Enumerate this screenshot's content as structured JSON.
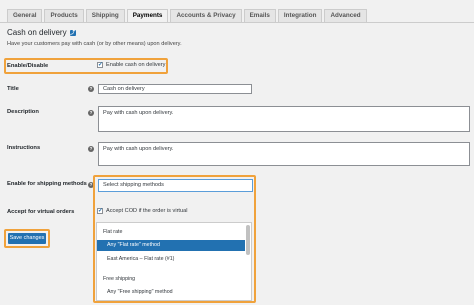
{
  "tabs": [
    "General",
    "Products",
    "Shipping",
    "Payments",
    "Accounts & Privacy",
    "Emails",
    "Integration",
    "Advanced"
  ],
  "active_tab": "Payments",
  "section": {
    "title": "Cash on delivery",
    "description": "Have your customers pay with cash (or by other means) upon delivery."
  },
  "fields": {
    "enable": {
      "label": "Enable/Disable",
      "checkbox_label": "Enable cash on delivery",
      "checked": true
    },
    "title": {
      "label": "Title",
      "value": "Cash on delivery"
    },
    "description": {
      "label": "Description",
      "value": "Pay with cash upon delivery."
    },
    "instructions": {
      "label": "Instructions",
      "value": "Pay with cash upon delivery."
    },
    "shipping_methods": {
      "label": "Enable for shipping methods",
      "placeholder": "Select shipping methods"
    },
    "virtual": {
      "label": "Accept for virtual orders",
      "checkbox_label": "Accept COD if the order is virtual",
      "checked": true
    }
  },
  "save_button": "Save changes",
  "help_tip_glyph": "?",
  "dropdown": {
    "groups": [
      {
        "name": "Flat rate",
        "options": [
          "Any \"Flat rate\" method",
          "East America – Flat rate (#1)"
        ]
      },
      {
        "name": "Free shipping",
        "options": [
          "Any \"Free shipping\" method"
        ]
      }
    ],
    "selected": "Any \"Flat rate\" method"
  },
  "colors": {
    "highlight": "#f0a23c",
    "accent": "#2271b1"
  }
}
